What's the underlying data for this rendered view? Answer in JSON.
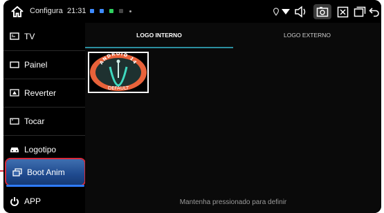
{
  "statusbar": {
    "title": "Configura",
    "time": "21:31"
  },
  "sidebar": {
    "items": [
      {
        "label": "TV",
        "icon": "tv-icon"
      },
      {
        "label": "Painel",
        "icon": "panel-icon"
      },
      {
        "label": "Reverter",
        "icon": "reverse-icon"
      },
      {
        "label": "Tocar",
        "icon": "touch-icon"
      },
      {
        "label": "Logotipo",
        "icon": "car-icon"
      },
      {
        "label": "Boot Anim",
        "icon": "boot-anim-icon",
        "active": true
      },
      {
        "label": "APP",
        "icon": "app-icon"
      }
    ]
  },
  "tabs": [
    {
      "label": "LOGO INTERNO",
      "active": true
    },
    {
      "label": "LOGO EXTERNO",
      "active": false
    }
  ],
  "logo_tile": {
    "arc_text": "ANDROID 14",
    "caption": "DEFAULT"
  },
  "hint": "Mantenha pressionado para definir",
  "colors": {
    "accent_blue": "#2f7cff",
    "highlight_red": "#d82a3a",
    "tab_indicator": "#2b8fa0",
    "logo_orange": "#e8623a"
  }
}
